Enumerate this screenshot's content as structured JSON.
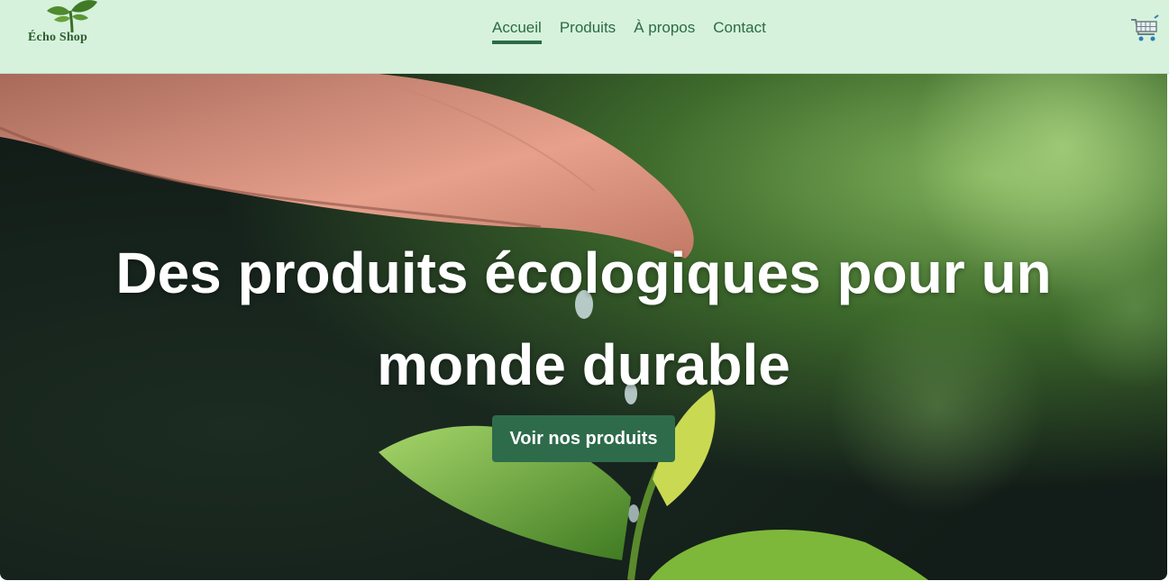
{
  "brand": {
    "name": "Écho Shop",
    "logo_icon": "sprout-icon"
  },
  "nav": {
    "items": [
      {
        "label": "Accueil",
        "active": true
      },
      {
        "label": "Produits",
        "active": false
      },
      {
        "label": "À propos",
        "active": false
      },
      {
        "label": "Contact",
        "active": false
      }
    ]
  },
  "cart": {
    "icon": "shopping-cart-icon"
  },
  "hero": {
    "title": "Des produits écologiques pour un monde durable",
    "cta_label": "Voir nos produits",
    "background": "hand-dripping-water-on-seedling-photo"
  },
  "colors": {
    "navbar_bg": "#d6f2dc",
    "accent": "#2e6b4b",
    "nav_text": "#2b6b45"
  }
}
